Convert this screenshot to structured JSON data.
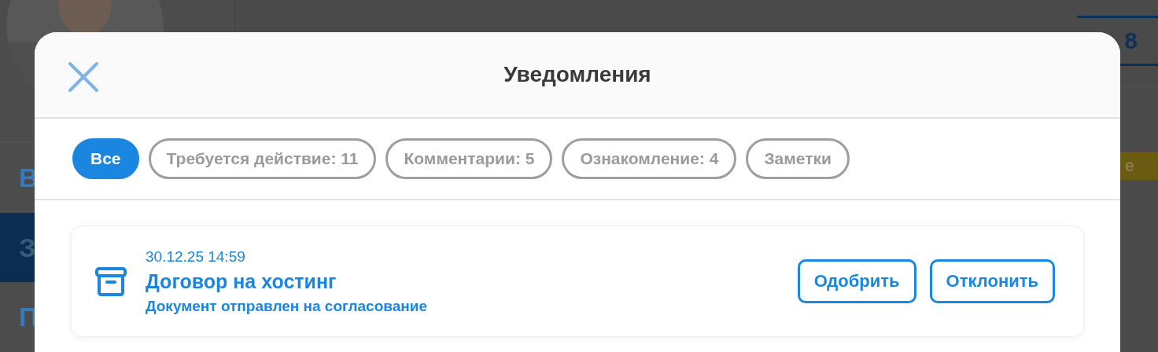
{
  "background": {
    "sidebar": {
      "items": [
        {
          "label": "В",
          "selected": false
        },
        {
          "label": "З",
          "selected": true
        },
        {
          "label": "П",
          "selected": false
        }
      ]
    },
    "counter": "8",
    "badge": "е"
  },
  "dialog": {
    "title": "Уведомления",
    "filters": [
      {
        "label": "Все",
        "selected": true
      },
      {
        "label": "Требуется действие: 11",
        "selected": false
      },
      {
        "label": "Комментарии: 5",
        "selected": false
      },
      {
        "label": "Ознакомление: 4",
        "selected": false
      },
      {
        "label": "Заметки",
        "selected": false
      }
    ],
    "notifications": [
      {
        "time": "30.12.25 14:59",
        "title": "Договор на хостинг",
        "subtitle": "Документ отправлен на согласование",
        "actions": [
          "Одобрить",
          "Отклонить"
        ]
      }
    ]
  }
}
